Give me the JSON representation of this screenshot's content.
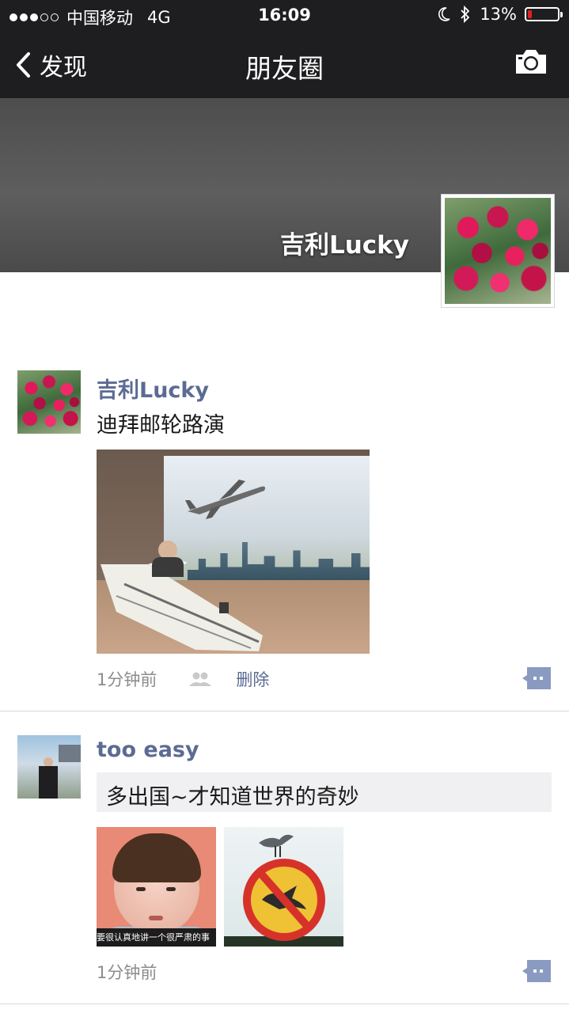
{
  "status_bar": {
    "carrier": "中国移动",
    "network": "4G",
    "time": "16:09",
    "battery": "13%",
    "battery_level": 0.13,
    "signal_bars_filled": 3,
    "signal_bars_total": 5
  },
  "nav": {
    "back_label": "发现",
    "title": "朋友圈"
  },
  "cover": {
    "user_name": "吉利Lucky"
  },
  "posts": [
    {
      "author": "吉利Lucky",
      "text": "迪拜邮轮路演",
      "time": "1分钟前",
      "delete_label": "删除"
    },
    {
      "author": "too easy",
      "text": "多出国~才知道世界的奇妙",
      "time": "1分钟前",
      "image_caption": "要很认真地讲一个很严肃的事"
    }
  ],
  "colors": {
    "bar_background": "#1e1e20",
    "author_link": "#5b6b93",
    "battery_low": "#e02020"
  }
}
